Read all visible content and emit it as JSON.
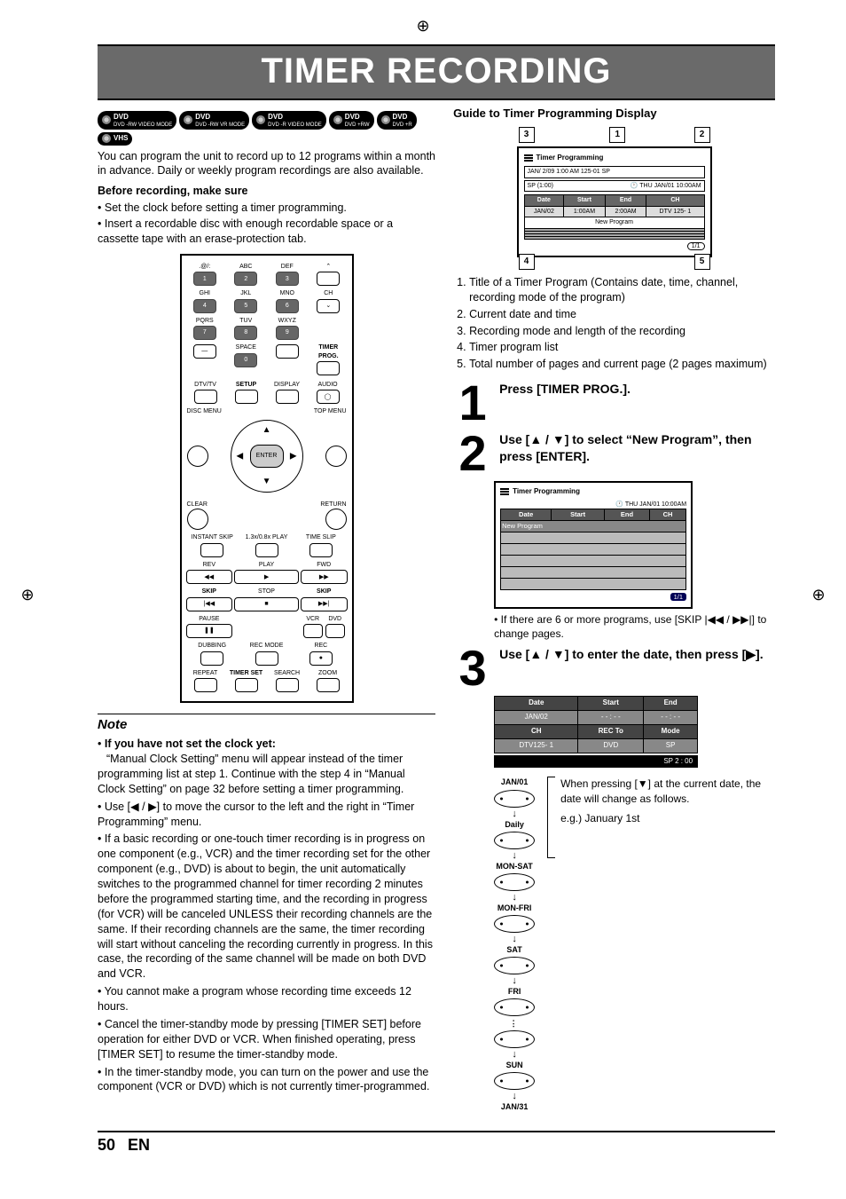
{
  "page": {
    "title": "TIMER RECORDING",
    "number": "50",
    "lang": "EN"
  },
  "badges": [
    "DVD -RW VIDEO MODE",
    "DVD -RW VR MODE",
    "DVD -R VIDEO MODE",
    "DVD +RW",
    "DVD +R",
    "VHS"
  ],
  "intro": "You can program the unit to record up to 12 programs within a month in advance. Daily or weekly program recordings are also available.",
  "before_head": "Before recording, make sure",
  "before_items": [
    "Set the clock before setting a timer programming.",
    "Insert a recordable disc with enough recordable space or a cassette tape with an erase-protection tab."
  ],
  "remote": {
    "keypad_labels": [
      ".@/:",
      "ABC",
      "DEF",
      "",
      "1",
      "2",
      "3",
      "",
      "GHI",
      "JKL",
      "MNO",
      "CH",
      "4",
      "5",
      "6",
      "",
      "PQRS",
      "TUV",
      "WXYZ",
      "",
      "7",
      "8",
      "9",
      "",
      "",
      "SPACE",
      "",
      "TIMER PROG.",
      "",
      "0",
      "",
      ""
    ],
    "row_setup": [
      "DTV/TV",
      "SETUP",
      "DISPLAY",
      "AUDIO"
    ],
    "menus": {
      "disc": "DISC MENU",
      "top": "TOP MENU",
      "clear": "CLEAR",
      "ret": "RETURN",
      "enter": "ENTER"
    },
    "skip_labels": [
      "INSTANT SKIP",
      "1.3x/0.8x PLAY",
      "TIME SLIP"
    ],
    "transport": {
      "rev": "REV",
      "play": "PLAY",
      "fwd": "FWD",
      "skipL": "SKIP",
      "stop": "STOP",
      "skipR": "SKIP",
      "pause": "PAUSE",
      "vcr": "VCR",
      "dvd": "DVD"
    },
    "bottom": {
      "dubbing": "DUBBING",
      "recmode": "REC MODE",
      "rec": "REC",
      "repeat": "REPEAT",
      "timerset": "TIMER SET",
      "search": "SEARCH",
      "zoom": "ZOOM"
    }
  },
  "note": {
    "head": "Note",
    "bold_intro": "If you have not set the clock yet:",
    "intro_text": "“Manual Clock Setting” menu will appear instead of the timer programming list at step 1. Continue with the step 4 in “Manual Clock Setting” on page 32 before setting a timer programming.",
    "items": [
      "Use [◀ / ▶] to move the cursor to the left and the right in “Timer Programming” menu.",
      "If a basic recording or one-touch timer recording is in progress on one component (e.g., VCR) and the timer recording set for the other component (e.g., DVD) is about to begin, the unit automatically switches to the programmed channel for timer recording 2 minutes before the programmed starting time, and the recording in progress (for VCR) will be canceled UNLESS their recording channels are the same. If their recording channels are the same, the timer recording will start without canceling the recording currently in progress. In this case, the recording of the same channel will be made on both DVD and VCR.",
      "You cannot make a program whose recording time exceeds 12 hours.",
      "Cancel the timer-standby mode by pressing [TIMER SET] before operation for either DVD or VCR. When finished operating, press [TIMER SET] to resume the timer-standby mode.",
      "In the timer-standby mode, you can turn on the power and use the component (VCR or DVD) which is not currently timer-programmed."
    ]
  },
  "guide": {
    "head": "Guide to Timer Programming Display",
    "callouts": [
      "1",
      "2",
      "3",
      "4",
      "5"
    ],
    "screen": {
      "title": "Timer Programming",
      "line1": "JAN/ 2/09 1:00 AM 125-01 SP",
      "sp": "SP (1:00)",
      "clock": "THU JAN/01 10:00AM",
      "headers": [
        "Date",
        "Start",
        "End",
        "CH"
      ],
      "row": [
        "JAN/02",
        "1:00AM",
        "2:00AM",
        "DTV 125- 1"
      ],
      "newprog": "New Program",
      "pages": "1/1"
    },
    "list": [
      "Title of a Timer Program (Contains date, time, channel, recording mode of the program)",
      "Current date and time",
      "Recording mode and length of the recording",
      "Timer program list",
      "Total number of pages and current page (2 pages maximum)"
    ]
  },
  "steps": {
    "s1": {
      "num": "1",
      "text": "Press [TIMER PROG.]."
    },
    "s2": {
      "num": "2",
      "text": "Use [▲ / ▼] to select “New Program”, then press [ENTER].",
      "screen": {
        "title": "Timer Programming",
        "clock": "THU JAN/01 10:00AM",
        "headers": [
          "Date",
          "Start",
          "End",
          "CH"
        ],
        "newprog": "New Program",
        "pages": "1/1"
      },
      "note": "If there are 6 or more programs, use [SKIP |◀◀ / ▶▶|] to change pages."
    },
    "s3": {
      "num": "3",
      "text": "Use [▲ / ▼] to enter the date, then press [▶].",
      "grid": {
        "headers": [
          "Date",
          "Start",
          "End"
        ],
        "r1": [
          "JAN/02",
          "- - : - -",
          "- - : - -"
        ],
        "headers2": [
          "CH",
          "REC To",
          "Mode"
        ],
        "r2": [
          "DTV125- 1",
          "DVD",
          "SP"
        ],
        "footer": "SP   2 : 00"
      },
      "flow": [
        "JAN/01",
        "Daily",
        "MON-SAT",
        "MON-FRI",
        "SAT",
        "FRI",
        "SUN",
        "JAN/31"
      ],
      "explain": "When pressing [▼] at the current date, the date will change as follows.",
      "eg": "e.g.) January 1st"
    }
  }
}
